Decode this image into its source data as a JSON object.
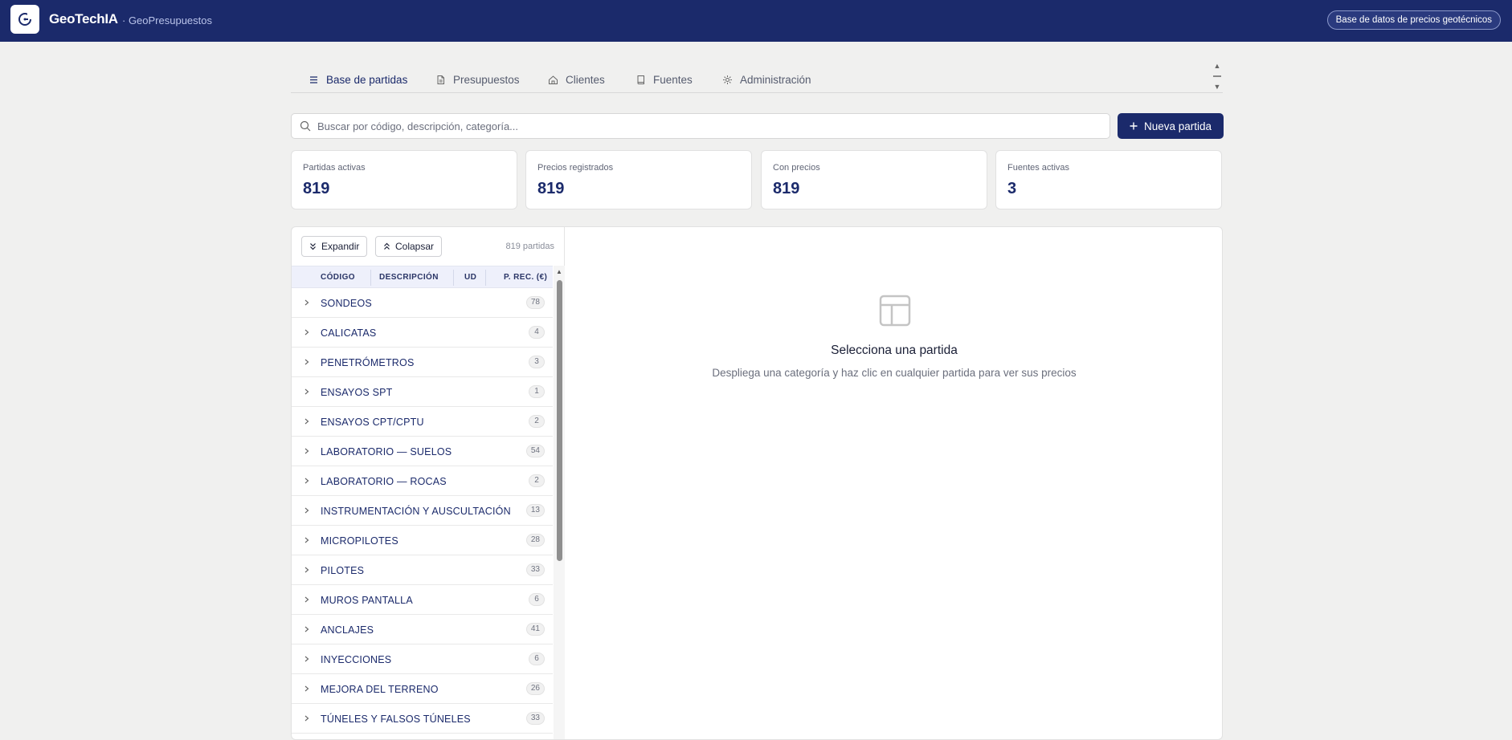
{
  "app": {
    "name": "GeoTechIA",
    "subtitle": "· GeoPresupuestos",
    "badge": "Base de datos de precios geotécnicos"
  },
  "tabs": [
    {
      "label": "Base de partidas",
      "icon": "list-icon",
      "active": true
    },
    {
      "label": "Presupuestos",
      "icon": "document-icon",
      "active": false
    },
    {
      "label": "Clientes",
      "icon": "home-icon",
      "active": false
    },
    {
      "label": "Fuentes",
      "icon": "book-icon",
      "active": false
    },
    {
      "label": "Administración",
      "icon": "gear-icon",
      "active": false
    }
  ],
  "search": {
    "placeholder": "Buscar por código, descripción, categoría..."
  },
  "new_button": {
    "label": "Nueva partida"
  },
  "stats": [
    {
      "label": "Partidas activas",
      "value": "819"
    },
    {
      "label": "Precios registrados",
      "value": "819"
    },
    {
      "label": "Con precios",
      "value": "819"
    },
    {
      "label": "Fuentes activas",
      "value": "3"
    }
  ],
  "tree": {
    "expand_label": "Expandir",
    "collapse_label": "Colapsar",
    "count_label": "819 partidas",
    "columns": [
      "CÓDIGO",
      "DESCRIPCIÓN",
      "UD",
      "P. REC. (€)"
    ],
    "categories": [
      {
        "name": "SONDEOS",
        "count": "78"
      },
      {
        "name": "CALICATAS",
        "count": "4"
      },
      {
        "name": "PENETRÓMETROS",
        "count": "3"
      },
      {
        "name": "ENSAYOS SPT",
        "count": "1"
      },
      {
        "name": "ENSAYOS CPT/CPTU",
        "count": "2"
      },
      {
        "name": "LABORATORIO — SUELOS",
        "count": "54"
      },
      {
        "name": "LABORATORIO — ROCAS",
        "count": "2"
      },
      {
        "name": "INSTRUMENTACIÓN Y AUSCULTACIÓN",
        "count": "13"
      },
      {
        "name": "MICROPILOTES",
        "count": "28"
      },
      {
        "name": "PILOTES",
        "count": "33"
      },
      {
        "name": "MUROS PANTALLA",
        "count": "6"
      },
      {
        "name": "ANCLAJES",
        "count": "41"
      },
      {
        "name": "INYECCIONES",
        "count": "6"
      },
      {
        "name": "MEJORA DEL TERRENO",
        "count": "26"
      },
      {
        "name": "TÚNELES Y FALSOS TÚNELES",
        "count": "33"
      }
    ]
  },
  "empty_state": {
    "title": "Selecciona una partida",
    "subtitle": "Despliega una categoría y haz clic en cualquier partida para ver sus precios"
  },
  "colors": {
    "brand": "#1b2a6b",
    "background": "#f0f0ef"
  }
}
